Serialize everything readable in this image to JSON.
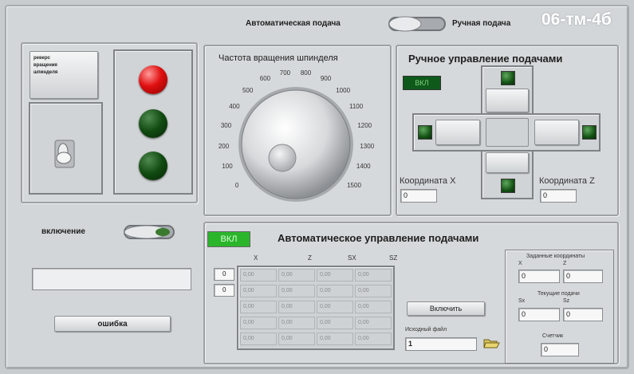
{
  "header": {
    "auto_label": "Автоматическая подача",
    "manual_label": "Ручная подача",
    "group_code": "06-тм-4б"
  },
  "left": {
    "spindle_reverse_button": "реверс вращения шпинделя",
    "power_label": "включение",
    "error_button": "ошибка",
    "status_text": ""
  },
  "spindle": {
    "title": "Частота вращения шпинделя",
    "ticks": [
      "0",
      "100",
      "200",
      "300",
      "400",
      "500",
      "600",
      "700",
      "800",
      "900",
      "1000",
      "1100",
      "1200",
      "1300",
      "1400",
      "1500"
    ],
    "value": 0
  },
  "manual": {
    "title": "Ручное управление подачами",
    "on_label": "ВКЛ",
    "coord_x_label": "Координата X",
    "coord_z_label": "Координата Z",
    "coord_x_value": "0",
    "coord_z_value": "0"
  },
  "auto": {
    "on_label": "ВКЛ",
    "title": "Автоматическое управление подачами",
    "columns": [
      "X",
      "Z",
      "SX",
      "SZ"
    ],
    "index_values": [
      "0",
      "0"
    ],
    "rows": [
      [
        "0,00",
        "0,00",
        "0,00",
        "0,00"
      ],
      [
        "0,00",
        "0,00",
        "0,00",
        "0,00"
      ],
      [
        "0,00",
        "0,00",
        "0,00",
        "0,00"
      ],
      [
        "0,00",
        "0,00",
        "0,00",
        "0,00"
      ],
      [
        "0,00",
        "0,00",
        "0,00",
        "0,00"
      ]
    ],
    "enable_button": "Включить",
    "source_file_label": "Исходный файл",
    "source_file_value": "1",
    "target_coords_label": "Заданные координаты",
    "target_x_label": "X",
    "target_z_label": "Z",
    "target_x_value": "0",
    "target_z_value": "0",
    "current_feed_label": "Текущие подачи",
    "feed_sx_label": "Sx",
    "feed_sz_label": "Sz",
    "feed_sx_value": "0",
    "feed_sz_value": "0",
    "counter_label": "Счетчик",
    "counter_value": "0"
  },
  "colors": {
    "background": "#c9cccf",
    "led_red": "#e01010",
    "led_green_off": "#114a11",
    "on_button": "#2bb52b",
    "group_code_text": "#ffffff"
  },
  "icons": [
    "toggle-switch-icon",
    "folder-icon"
  ]
}
